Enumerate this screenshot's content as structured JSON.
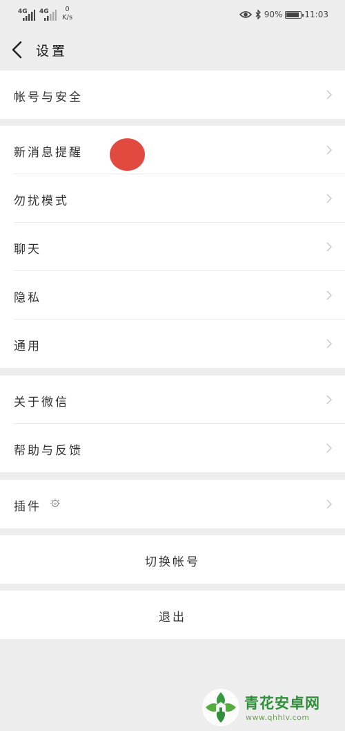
{
  "status_bar": {
    "network1": "4G",
    "network2": "4G",
    "speed_value": "0",
    "speed_unit": "K/s",
    "battery_text": "90%",
    "battery_level": 0.9,
    "time": "11:03",
    "icons": [
      "eye-icon",
      "bluetooth-icon",
      "battery-icon"
    ]
  },
  "nav": {
    "title": "设置",
    "back_icon": "chevron-left-icon"
  },
  "groups": {
    "account": [
      {
        "label": "帐号与安全"
      }
    ],
    "main": [
      {
        "label": "新消息提醒"
      },
      {
        "label": "勿扰模式"
      },
      {
        "label": "聊天"
      },
      {
        "label": "隐私"
      },
      {
        "label": "通用"
      }
    ],
    "about": [
      {
        "label": "关于微信"
      },
      {
        "label": "帮助与反馈"
      }
    ],
    "plugins": [
      {
        "label": "插件"
      }
    ]
  },
  "actions": {
    "switch_account": "切换帐号",
    "logout": "退出"
  },
  "colors": {
    "background": "#ededed",
    "cell": "#ffffff",
    "marker": "#e2493f",
    "watermark_green": "#2f8f3a"
  },
  "watermark": {
    "title": "青花安卓网",
    "url": "www.qhhlv.com"
  }
}
